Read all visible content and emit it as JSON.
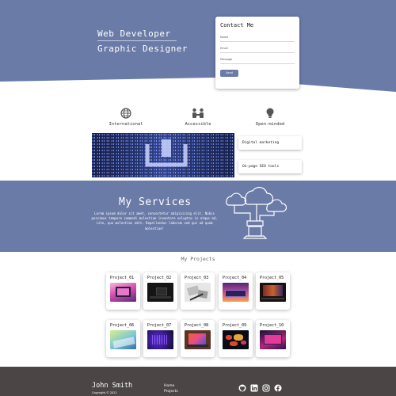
{
  "hero": {
    "title_line1": "Web Developer",
    "title_line2": "Graphic Designer",
    "background_color": "#6b7ba8"
  },
  "contact": {
    "title": "Contact Me",
    "name_label": "Name",
    "email_label": "Email",
    "message_label": "Message",
    "send_label": "Send"
  },
  "features": [
    {
      "label": "International",
      "icon": "globe-icon"
    },
    {
      "label": "Accessible",
      "icon": "people-icon"
    },
    {
      "label": "Open-minded",
      "icon": "lightbulb-icon"
    }
  ],
  "tags": [
    "Digital marketing",
    "On-page SEO tools"
  ],
  "services": {
    "title": "My Services",
    "text": "Lorem ipsum dolor sit amet, consectetur adipisicing elit. Nobis possimus tempore commodi molestiae inventore voluptas in atque ad, iste, quo molestias odit. Repellendus laborum sed qui ad quam molestiae!"
  },
  "projects": {
    "heading": "My Projects",
    "items": [
      {
        "name": "Project_01"
      },
      {
        "name": "Project_02"
      },
      {
        "name": "Project_03"
      },
      {
        "name": "Project_04"
      },
      {
        "name": "Project_05"
      },
      {
        "name": "Project_06"
      },
      {
        "name": "Project_07"
      },
      {
        "name": "Project_08"
      },
      {
        "name": "Project_09"
      },
      {
        "name": "Project_10"
      }
    ]
  },
  "footer": {
    "name": "John Smith",
    "copyright": "Copyright © 2021",
    "links": [
      "Home",
      "Projects"
    ],
    "social_icons": [
      "github-icon",
      "linkedin-icon",
      "instagram-icon",
      "facebook-icon"
    ]
  }
}
